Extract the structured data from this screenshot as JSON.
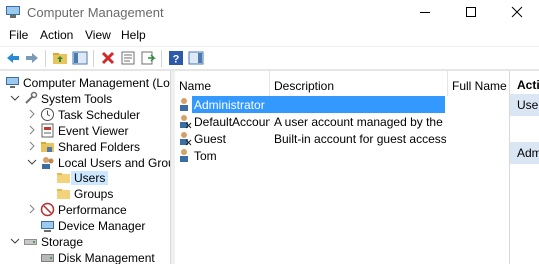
{
  "window": {
    "title": "Computer Management"
  },
  "menu": {
    "file": "File",
    "action": "Action",
    "view": "View",
    "help": "Help"
  },
  "toolbar": {
    "buttons": [
      "back-icon",
      "forward-icon",
      "up-folder-icon",
      "show-hide-tree-icon",
      "delete-icon",
      "properties-icon",
      "export-list-icon",
      "help-icon",
      "show-hide-action-pane-icon"
    ]
  },
  "tree": {
    "root": "Computer Management (Local",
    "system_tools": "System Tools",
    "task_scheduler": "Task Scheduler",
    "event_viewer": "Event Viewer",
    "shared_folders": "Shared Folders",
    "local_users_groups": "Local Users and Groups",
    "users": "Users",
    "groups": "Groups",
    "performance": "Performance",
    "device_manager": "Device Manager",
    "storage": "Storage",
    "disk_management": "Disk Management"
  },
  "list": {
    "columns": {
      "name": "Name",
      "description": "Description",
      "full_name": "Full Name"
    },
    "rows": [
      {
        "name": "Administrator",
        "description": "",
        "full_name": ""
      },
      {
        "name": "DefaultAccount",
        "description": "A user account managed by the s...",
        "full_name": ""
      },
      {
        "name": "Guest",
        "description": "Built-in account for guest access t...",
        "full_name": ""
      },
      {
        "name": "Tom",
        "description": "",
        "full_name": ""
      }
    ]
  },
  "actions": {
    "header": "Actio",
    "section1": "Users",
    "section2": "Admi"
  },
  "colors": {
    "selection": "#3399ff",
    "tree_selection": "#cce8ff",
    "action_section": "#dae6f3"
  }
}
